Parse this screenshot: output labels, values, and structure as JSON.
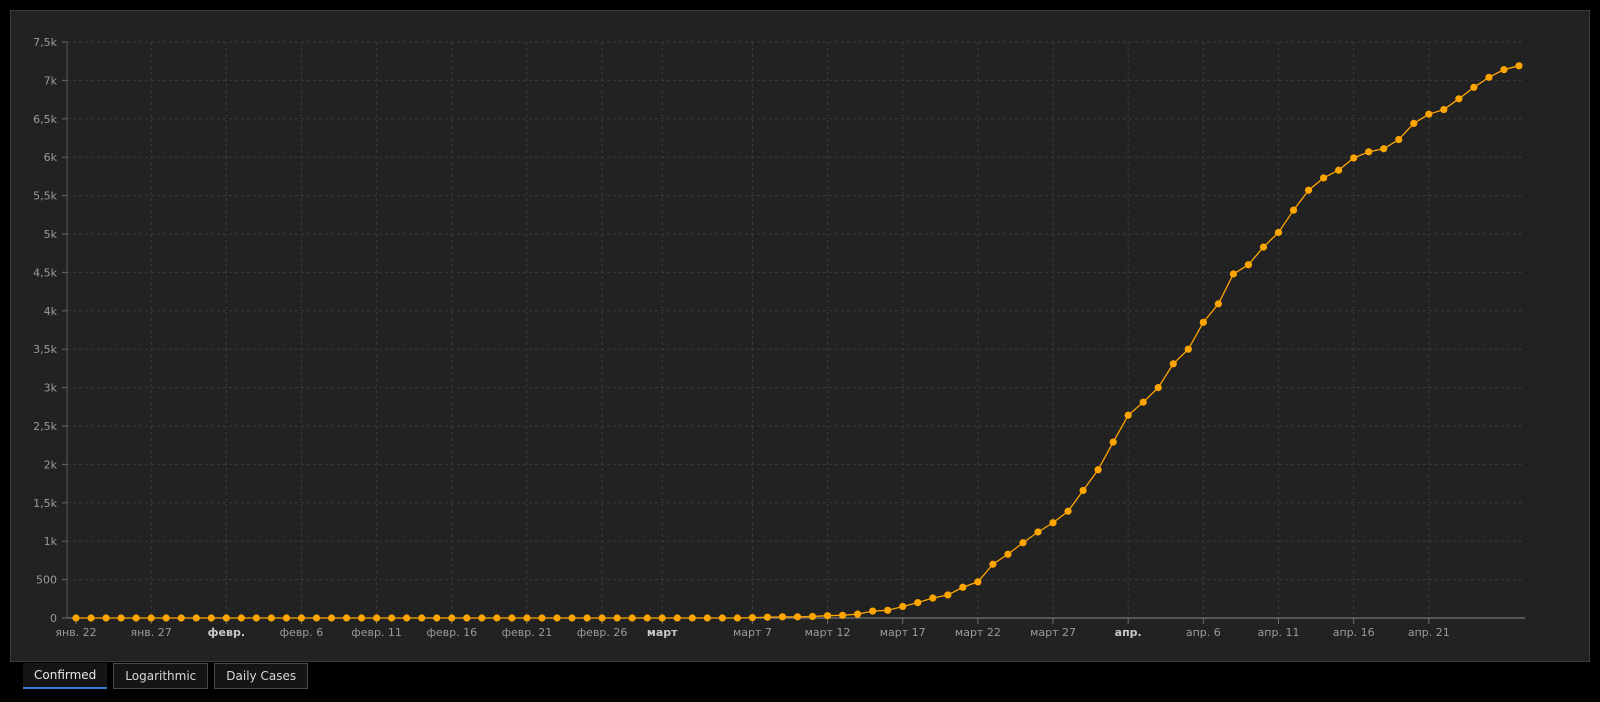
{
  "colors": {
    "background": "#222222",
    "series": "#ffa500",
    "grid": "#3a3a3a",
    "tab_active_underline": "#2f7fd6"
  },
  "tabs": [
    {
      "label": "Confirmed",
      "active": true
    },
    {
      "label": "Logarithmic",
      "active": false
    },
    {
      "label": "Daily Cases",
      "active": false
    }
  ],
  "chart_data": {
    "type": "line",
    "title": "",
    "xlabel": "",
    "ylabel": "",
    "grid": true,
    "ylim": [
      0,
      7500
    ],
    "yticks": [
      {
        "value": 0,
        "label": "0"
      },
      {
        "value": 500,
        "label": "500"
      },
      {
        "value": 1000,
        "label": "1k"
      },
      {
        "value": 1500,
        "label": "1,5k"
      },
      {
        "value": 2000,
        "label": "2k"
      },
      {
        "value": 2500,
        "label": "2,5k"
      },
      {
        "value": 3000,
        "label": "3k"
      },
      {
        "value": 3500,
        "label": "3,5k"
      },
      {
        "value": 4000,
        "label": "4k"
      },
      {
        "value": 4500,
        "label": "4,5k"
      },
      {
        "value": 5000,
        "label": "5k"
      },
      {
        "value": 5500,
        "label": "5,5k"
      },
      {
        "value": 6000,
        "label": "6k"
      },
      {
        "value": 6500,
        "label": "6,5k"
      },
      {
        "value": 7000,
        "label": "7k"
      },
      {
        "value": 7500,
        "label": "7,5k"
      }
    ],
    "xticks": [
      {
        "date": "2020-01-22",
        "label": "янв. 22",
        "bold": false
      },
      {
        "date": "2020-01-27",
        "label": "янв. 27",
        "bold": false
      },
      {
        "date": "2020-02-01",
        "label": "февр.",
        "bold": true
      },
      {
        "date": "2020-02-06",
        "label": "февр. 6",
        "bold": false
      },
      {
        "date": "2020-02-11",
        "label": "февр. 11",
        "bold": false
      },
      {
        "date": "2020-02-16",
        "label": "февр. 16",
        "bold": false
      },
      {
        "date": "2020-02-21",
        "label": "февр. 21",
        "bold": false
      },
      {
        "date": "2020-02-26",
        "label": "февр. 26",
        "bold": false
      },
      {
        "date": "2020-03-01",
        "label": "март",
        "bold": true
      },
      {
        "date": "2020-03-07",
        "label": "март 7",
        "bold": false
      },
      {
        "date": "2020-03-12",
        "label": "март 12",
        "bold": false
      },
      {
        "date": "2020-03-17",
        "label": "март 17",
        "bold": false
      },
      {
        "date": "2020-03-22",
        "label": "март 22",
        "bold": false
      },
      {
        "date": "2020-03-27",
        "label": "март 27",
        "bold": false
      },
      {
        "date": "2020-04-01",
        "label": "апр.",
        "bold": true
      },
      {
        "date": "2020-04-06",
        "label": "апр. 6",
        "bold": false
      },
      {
        "date": "2020-04-11",
        "label": "апр. 11",
        "bold": false
      },
      {
        "date": "2020-04-16",
        "label": "апр. 16",
        "bold": false
      },
      {
        "date": "2020-04-21",
        "label": "апр. 21",
        "bold": false
      }
    ],
    "x_start": "2020-01-22",
    "x_end": "2020-04-23",
    "series": [
      {
        "values": [
          0,
          0,
          0,
          0,
          0,
          0,
          0,
          0,
          0,
          0,
          0,
          0,
          0,
          0,
          0,
          0,
          0,
          0,
          0,
          0,
          0,
          0,
          0,
          0,
          0,
          0,
          0,
          0,
          0,
          0,
          0,
          0,
          0,
          0,
          0,
          0,
          0,
          0,
          0,
          0,
          0,
          0,
          0,
          0,
          0,
          5,
          10,
          15,
          15,
          20,
          30,
          35,
          50,
          90,
          100,
          150,
          200,
          260,
          300,
          400,
          470,
          700,
          830,
          980,
          1120,
          1240,
          1390,
          1660,
          1930,
          2290,
          2640,
          2810,
          3000,
          3310,
          3500,
          3850,
          4090,
          4480,
          4600,
          4830,
          5020,
          5310,
          5570,
          5730,
          5830,
          5990,
          6070,
          6110,
          6230,
          6440,
          6560,
          6620,
          6760,
          6910,
          7040,
          7140,
          7190
        ]
      }
    ]
  }
}
